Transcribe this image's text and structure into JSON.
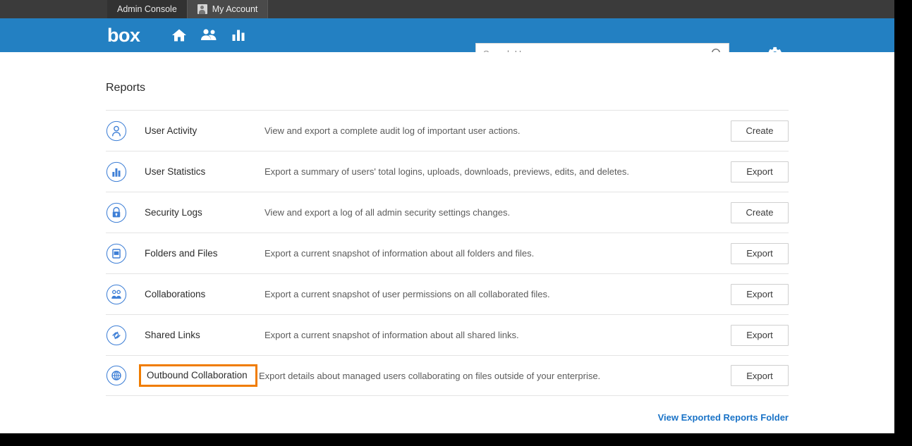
{
  "browser": {
    "tabs": [
      {
        "label": "Admin Console",
        "active": true,
        "icon": null
      },
      {
        "label": "My Account",
        "active": false,
        "icon": "user-avatar-icon"
      }
    ]
  },
  "navbar": {
    "brand": "box",
    "brand_color": "#ffffff",
    "background_color": "#2380c2",
    "icons": [
      {
        "name": "home-icon",
        "label": "Home"
      },
      {
        "name": "users-icon",
        "label": "Users"
      },
      {
        "name": "reports-bar-chart-icon",
        "label": "Reports"
      }
    ],
    "search": {
      "placeholder": "Search Users",
      "value": "",
      "icon": "search-icon"
    },
    "settings": {
      "name": "gear-icon",
      "label": "Settings"
    }
  },
  "page": {
    "title": "Reports",
    "footer_link": "View Exported Reports Folder",
    "footer_link_color": "#1a73c7"
  },
  "highlight": {
    "target": "Outbound Collaboration",
    "color": "#f07c00"
  },
  "reports": [
    {
      "icon": "user-activity-icon",
      "name": "User Activity",
      "description": "View and export a complete audit log of important user actions.",
      "action": "Create"
    },
    {
      "icon": "user-statistics-icon",
      "name": "User Statistics",
      "description": "Export a summary of users' total logins, uploads, downloads, previews, edits, and deletes.",
      "action": "Export"
    },
    {
      "icon": "security-lock-icon",
      "name": "Security Logs",
      "description": "View and export a log of all admin security settings changes.",
      "action": "Create"
    },
    {
      "icon": "folder-icon",
      "name": "Folders and Files",
      "description": "Export a current snapshot of information about all folders and files.",
      "action": "Export"
    },
    {
      "icon": "collaborations-people-icon",
      "name": "Collaborations",
      "description": "Export a current snapshot of user permissions on all collaborated files.",
      "action": "Export"
    },
    {
      "icon": "shared-link-icon",
      "name": "Shared Links",
      "description": "Export a current snapshot of information about all shared links.",
      "action": "Export"
    },
    {
      "icon": "globe-outbound-icon",
      "name": "Outbound Collaboration",
      "description": "Export details about managed users collaborating on files outside of your enterprise.",
      "action": "Export"
    }
  ]
}
